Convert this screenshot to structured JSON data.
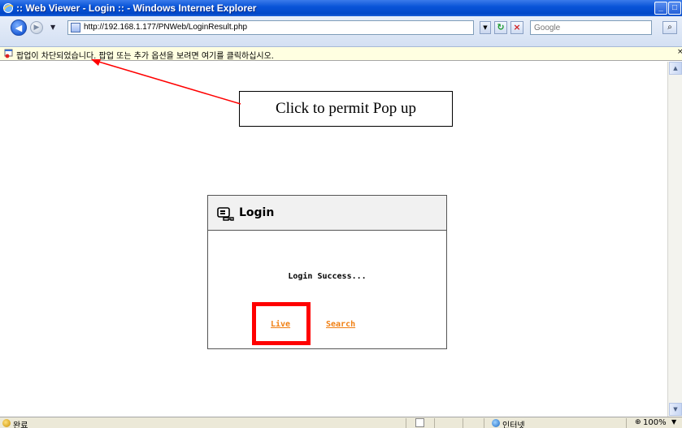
{
  "window": {
    "title": ":: Web Viewer - Login :: - Windows Internet Explorer",
    "icon": "ie-icon"
  },
  "toolbar": {
    "url": "http://192.168.1.177/PNWeb/LoginResult.php",
    "search_placeholder": "Google"
  },
  "infobar": {
    "text": "팝업이 차단되었습니다. 팝업 또는 추가 옵션을 보려면 여기를 클릭하십시오."
  },
  "annotation": {
    "callout_text": "Click to permit Pop up",
    "arrow_color": "#ff0000",
    "highlight_color": "#ff0000"
  },
  "login": {
    "title": "Login",
    "message": "Login Success...",
    "live_label": "Live",
    "search_label": "Search",
    "link_color": "#f07f12"
  },
  "statusbar": {
    "status_text": "완료",
    "zone_text": "인터넷",
    "zoom_text": "100%"
  }
}
